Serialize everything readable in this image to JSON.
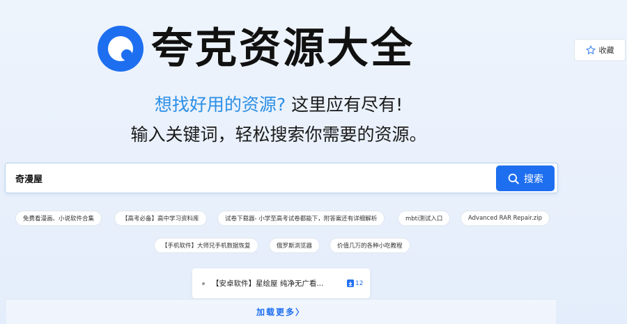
{
  "brand": {
    "name": "夸克资源大全",
    "logo_icon": "quark-logo-icon",
    "color": "#1e6ff0"
  },
  "favorite": {
    "label": "收藏",
    "icon": "star-outline-icon"
  },
  "tagline": {
    "line1_highlight": "想找好用的资源?",
    "line1_rest": "这里应有尽有!",
    "line2": "输入关键词，轻松搜索你需要的资源。"
  },
  "search": {
    "value": "奇漫屋",
    "button_label": "搜索",
    "button_icon": "search-icon"
  },
  "chips": [
    "免费看漫画、小说软件合集",
    "【高考必备】高中学习资料库",
    "试卷下载器- 小学至高考试卷都能下，附答案还有详细解析",
    "mbti测试入口",
    "Advanced RAR Repair.zip",
    "【手机软件】大师兄手机数据恢复",
    "俄罗斯浏览器",
    "价值几万的各种小吃教程"
  ],
  "results": [
    {
      "title": "【安卓软件】星绘屋 纯净无广看...",
      "count": "12",
      "icon": "download-icon"
    }
  ],
  "load_more": {
    "label": "加载更多",
    "icon": "chevron-right-icon"
  }
}
